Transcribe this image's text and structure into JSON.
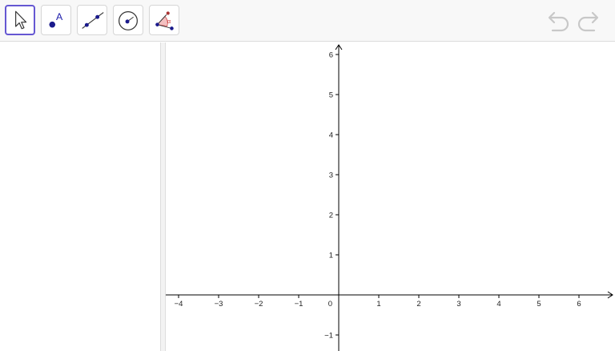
{
  "toolbar": {
    "tools": [
      {
        "id": "move",
        "icon": "cursor-arrow-icon",
        "selected": true
      },
      {
        "id": "point",
        "icon": "point-icon",
        "label": "A",
        "selected": false
      },
      {
        "id": "line",
        "icon": "line-through-two-points-icon",
        "selected": false
      },
      {
        "id": "circle",
        "icon": "circle-with-center-icon",
        "selected": false
      },
      {
        "id": "angle",
        "icon": "angle-icon",
        "label": "α",
        "selected": false
      }
    ],
    "undo_icon": "undo-icon",
    "redo_icon": "redo-icon"
  },
  "colors": {
    "accent": "#6557d2",
    "point": "#1a1a8c",
    "angle_fill": "#f3c0c0",
    "axis": "#000000",
    "disabled": "#c8c8c8"
  },
  "graphics": {
    "x_ticks": [
      "−4",
      "−3",
      "−2",
      "−1",
      "1",
      "2",
      "3",
      "4",
      "5",
      "6"
    ],
    "y_ticks": [
      "−1",
      "1",
      "2",
      "3",
      "4",
      "5",
      "6"
    ],
    "origin_label": "0"
  }
}
